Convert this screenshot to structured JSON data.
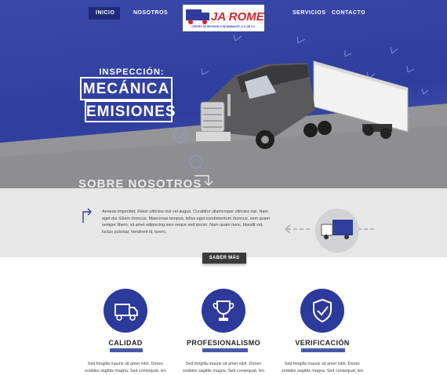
{
  "nav": {
    "items": [
      {
        "label": "INICIO",
        "active": true
      },
      {
        "label": "NOSOTROS",
        "active": false
      },
      {
        "label": "SERVICIOS",
        "active": false
      },
      {
        "label": "CONTACTO",
        "active": false
      }
    ]
  },
  "logo": {
    "name": "JA ROMER",
    "subtitle": "CENTRO DE REVISIÓN CONTAMINANTE, S.A. DE C.V."
  },
  "hero": {
    "line1": "INSPECCIÓN:",
    "line2": "MECÁNICA",
    "line3": "EMISIONES"
  },
  "about": {
    "title": "SOBRE NOSOTROS",
    "text": "Aenean imperdiet. Etiam ultricies nisi vel augue. Curabitur ullamcorper ultricies nisi. Nam eget dui. Etiam rhoncus. Maecenas tempus, tellus eget condimentum rhoncus, sem quam semper libero, sit amet adipiscing sem neque sed ipsum. Nam quam nunc, blandit vel, luctus pulvinar, hendrerit id, lorem.",
    "button": "SABER MÁS"
  },
  "features": [
    {
      "title": "CALIDAD",
      "icon": "truck-icon",
      "text": "Sed fringilla mauris sit amet nibh. Donec sodales sagittis magna. Sed consequat, leo"
    },
    {
      "title": "PROFESIONALISMO",
      "icon": "trophy-icon",
      "text": "Sed fringilla mauris sit amet nibh. Donec sodales sagittis magna. Sed consequat, leo"
    },
    {
      "title": "VERIFICACIÓN",
      "icon": "shield-check-icon",
      "text": "Sed fringilla mauris sit amet nibh. Donec sodales sagittis magna. Sed consequat, leo"
    }
  ],
  "colors": {
    "brand_blue": "#2f3d9e",
    "nav_active": "#1f2b7a",
    "logo_red": "#d4262b",
    "about_bg": "#e7e7e8",
    "button_dark": "#3a3a3a"
  }
}
